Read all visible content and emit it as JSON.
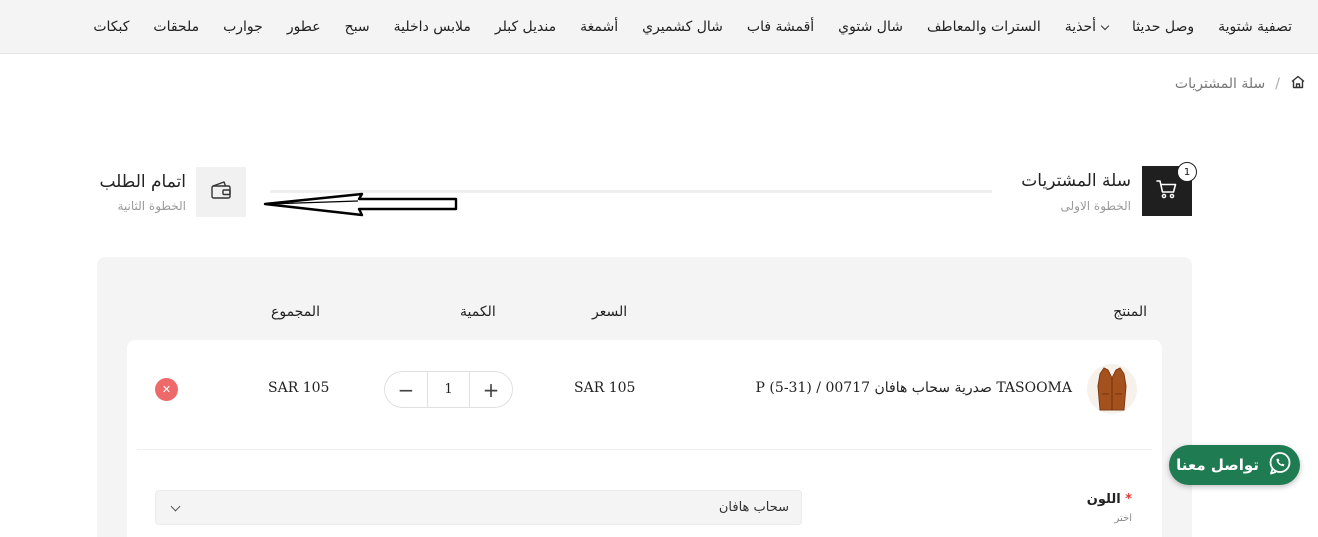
{
  "nav": {
    "items": [
      {
        "label": "تصفية شتوية"
      },
      {
        "label": "وصل حديثا"
      },
      {
        "label": "أحذية"
      },
      {
        "label": "السترات والمعاطف"
      },
      {
        "label": "شال شتوي"
      },
      {
        "label": "أقمشة فاب"
      },
      {
        "label": "شال كشميري"
      },
      {
        "label": "أشمغة"
      },
      {
        "label": "منديل كبلر"
      },
      {
        "label": "ملابس داخلية"
      },
      {
        "label": "سبح"
      },
      {
        "label": "عطور"
      },
      {
        "label": "جوارب"
      },
      {
        "label": "ملحقات"
      },
      {
        "label": "كبكات"
      }
    ]
  },
  "breadcrumb": {
    "home_icon": "home-icon",
    "separator": "/",
    "current": "سلة المشتريات"
  },
  "steps": {
    "step1": {
      "title": "سلة المشتريات",
      "subtitle": "الخطوة الاولى",
      "badge": "1",
      "icon": "cart-icon"
    },
    "step2": {
      "title": "اتمام الطلب",
      "subtitle": "الخطوة الثانية",
      "icon": "wallet-icon"
    }
  },
  "table": {
    "headers": {
      "product": "المنتج",
      "price": "السعر",
      "quantity": "الكمية",
      "total": "المجموع"
    }
  },
  "cart_item": {
    "name": "P صدرية سحاب هافان 00717 / (31-5) TASOOMA",
    "price": "SAR 105",
    "quantity": "1",
    "total": "SAR 105",
    "minus": "−",
    "plus": "+",
    "remove": "✕",
    "option": {
      "label": "اللون",
      "required_mark": "*",
      "hint": "اختر",
      "selected": "سحاب هافان"
    }
  },
  "whatsapp": {
    "label": "تواصل معنا",
    "icon": "whatsapp-icon"
  },
  "colors": {
    "nav_bg": "#f4f4f5",
    "dark": "#1f1f1f",
    "whatsapp": "#1e7b52",
    "remove": "#ee6a6a",
    "panel_bg": "#f4f4f5"
  }
}
